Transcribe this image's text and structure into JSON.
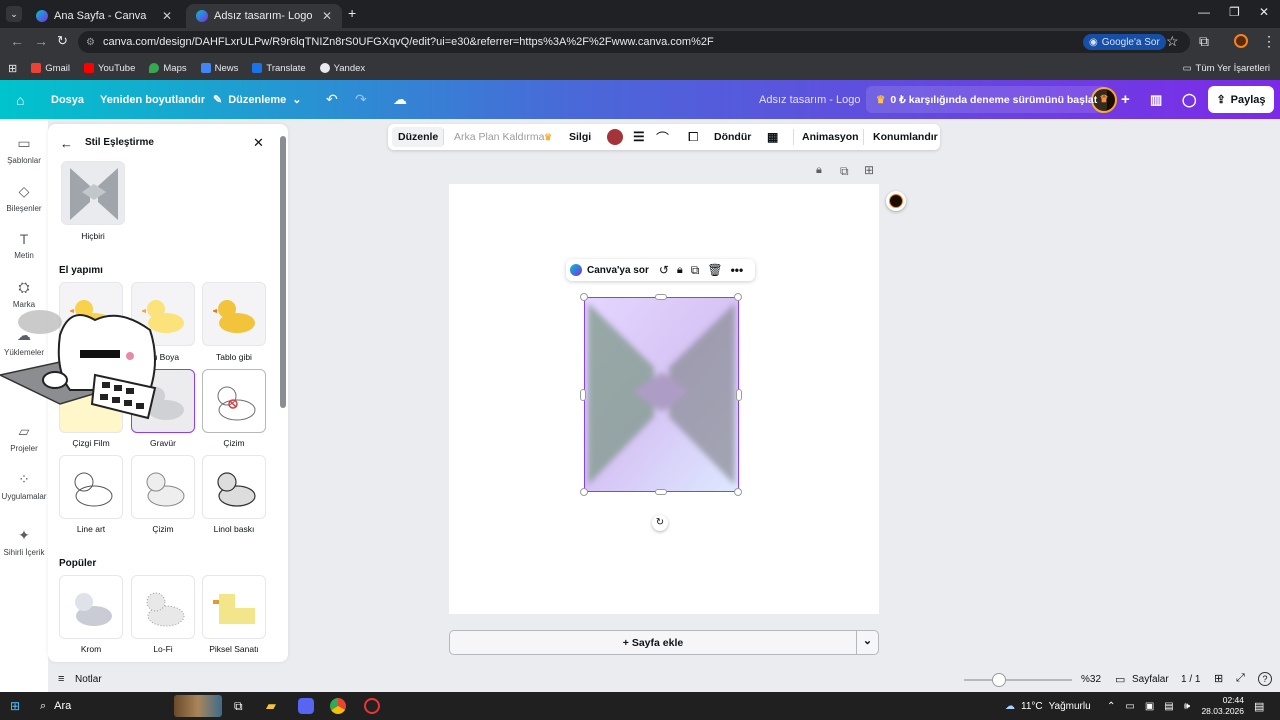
{
  "browser": {
    "tabs": [
      {
        "title": "Ana Sayfa - Canva",
        "active": false
      },
      {
        "title": "Adsız tasarım- Logo",
        "active": true
      }
    ],
    "new_tab_icon": "+",
    "url": "canva.com/design/DAHFLxrULPw/R9r6lqTNIZn8rS0UFGXqvQ/edit?ui=e30&referrer=https%3A%2F%2Fwww.canva.com%2F",
    "google_sor": "Google'a Sor",
    "bookmarks": [
      "Gmail",
      "YouTube",
      "Maps",
      "News",
      "Translate",
      "Yandex"
    ],
    "all_bookmarks": "Tüm Yer İşaretleri"
  },
  "header": {
    "home_icon": "home-icon",
    "file": "Dosya",
    "resize": "Yeniden boyutlandır",
    "editing": "Düzenleme",
    "doc_title": "Adsız tasarım - Logo",
    "trial": "0 ₺ karşılığında deneme sürümünü başlat",
    "share": "Paylaş",
    "accent": "#7d2ae8"
  },
  "rail": [
    {
      "label": "Şablonlar",
      "icon": "layout-icon"
    },
    {
      "label": "Bileşenler",
      "icon": "shapes-icon"
    },
    {
      "label": "Metin",
      "icon": "text-icon"
    },
    {
      "label": "Marka",
      "icon": "brand-icon"
    },
    {
      "label": "Yüklemeler",
      "icon": "upload-icon"
    },
    {
      "label": "Projeler",
      "icon": "folder-icon"
    },
    {
      "label": "Uygulamalar",
      "icon": "apps-icon"
    },
    {
      "label": "Sihirli İçerik",
      "icon": "magic-icon"
    }
  ],
  "panel": {
    "title": "Stil Eşleştirme",
    "none_label": "Hiçbiri",
    "section_handmade": "El yapımı",
    "handmade": [
      "",
      "Su Boya",
      "Tablo gibi",
      "Çizgi Film",
      "Gravür",
      "Çizim",
      "Line art",
      "Çizim",
      "Linol baskı"
    ],
    "section_popular": "Popüler",
    "popular": [
      "Krom",
      "Lo-Fi",
      "Piksel Sanatı"
    ]
  },
  "context_toolbar": {
    "edit": "Düzenle",
    "bg_remove": "Arka Plan Kaldırma",
    "eraser": "Silgi",
    "color": "#a4343a",
    "rotate": "Döndür",
    "animation": "Animasyon",
    "position": "Konumlandır"
  },
  "floating_bar": {
    "ask": "Canva'ya sor"
  },
  "add_page": "+ Sayfa ekle",
  "footer": {
    "notes": "Notlar",
    "zoom": "%32",
    "zoom_fraction": 0.32,
    "pages_label": "Sayfalar",
    "page_count": "1 / 1"
  },
  "taskbar": {
    "search": "Ara",
    "weather": "11°C",
    "weather_desc": "Yağmurlu",
    "time": "02:44",
    "date": "28.03.2026"
  }
}
